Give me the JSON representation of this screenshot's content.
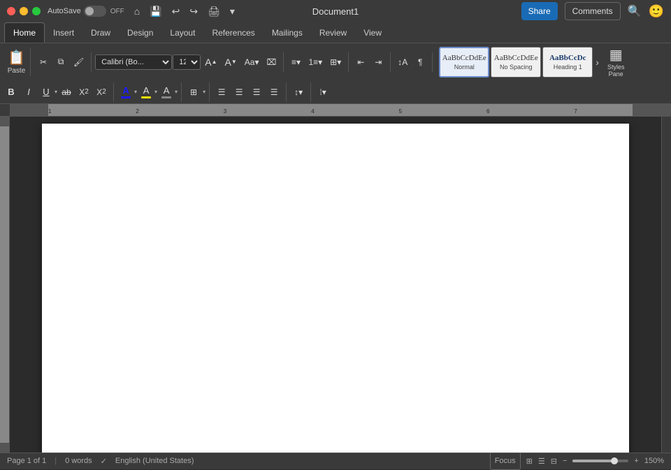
{
  "titlebar": {
    "doc_title": "Document1",
    "autosave_label": "AutoSave",
    "autosave_state": "OFF",
    "search_icon": "🔍",
    "face_icon": "🙂"
  },
  "tabs": [
    {
      "label": "Home",
      "active": true
    },
    {
      "label": "Insert",
      "active": false
    },
    {
      "label": "Draw",
      "active": false
    },
    {
      "label": "Design",
      "active": false
    },
    {
      "label": "Layout",
      "active": false
    },
    {
      "label": "References",
      "active": false
    },
    {
      "label": "Mailings",
      "active": false
    },
    {
      "label": "Review",
      "active": false
    },
    {
      "label": "View",
      "active": false
    }
  ],
  "toolbar": {
    "share_label": "Share",
    "comments_label": "Comments",
    "paste_label": "Paste",
    "font_name": "Calibri (Bo...",
    "font_size": "12",
    "bold": "B",
    "italic": "I",
    "underline": "U",
    "strikethrough": "ab",
    "subscript": "X₂",
    "superscript": "X²",
    "font_color_label": "A",
    "highlight_label": "A",
    "increase_font": "A",
    "decrease_font": "A",
    "change_case": "Aa",
    "clear_format": "⌧"
  },
  "styles": [
    {
      "label": "Normal",
      "preview": "AaBbCcDdEe",
      "active": true
    },
    {
      "label": "No Spacing",
      "preview": "AaBbCcDdEe",
      "active": false
    },
    {
      "label": "Heading 1",
      "preview": "AaBbCcDc",
      "active": false
    }
  ],
  "styles_pane": {
    "label": "Styles\nPane",
    "icon": "▦"
  },
  "statusbar": {
    "page_info": "Page 1 of 1",
    "words": "0 words",
    "language": "English (United States)",
    "focus": "Focus",
    "zoom_percent": "150%",
    "zoom_minus": "−",
    "zoom_plus": "+"
  }
}
